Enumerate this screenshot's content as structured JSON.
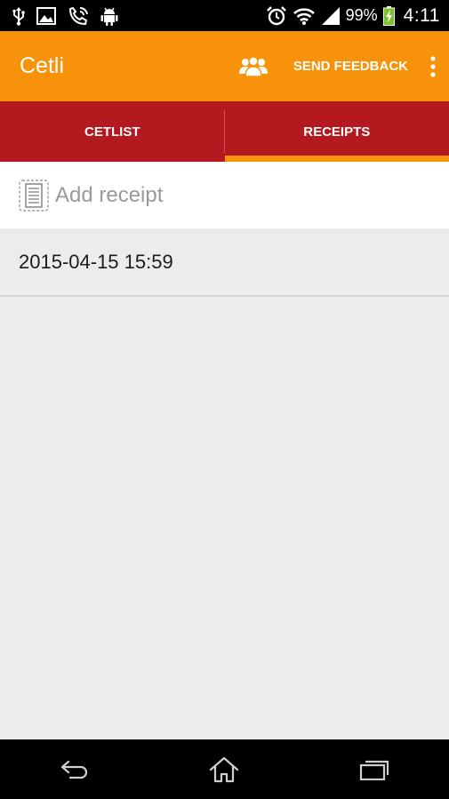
{
  "status_bar": {
    "notification_icons": [
      "usb-icon",
      "image-icon",
      "phone-icon",
      "android-icon"
    ],
    "system_icons": [
      "alarm-icon",
      "wifi-icon",
      "signal-icon",
      "battery-charging-icon"
    ],
    "battery_percent": "99%",
    "time": "4:11"
  },
  "action_bar": {
    "title": "Cetli",
    "people_icon": "people-icon",
    "send_feedback_label": "SEND FEEDBACK",
    "overflow_icon": "overflow-menu-icon",
    "background_color": "#f7920a"
  },
  "tabs": {
    "items": [
      {
        "label": "CETLIST",
        "selected": false
      },
      {
        "label": "RECEIPTS",
        "selected": true
      }
    ],
    "background_color": "#b3191f",
    "indicator_color": "#f7920a"
  },
  "add_receipt": {
    "icon": "receipt-icon",
    "label": "Add receipt"
  },
  "receipts": [
    {
      "date": "2015-04-15 15:59"
    }
  ],
  "nav_bar": {
    "buttons": [
      "back-icon",
      "home-icon",
      "recent-apps-icon"
    ]
  }
}
